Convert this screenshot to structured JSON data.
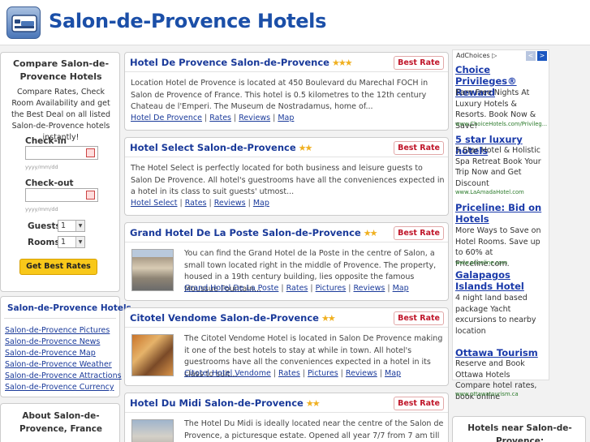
{
  "header": {
    "site_title": "Salon-de-Provence Hotels",
    "logo_icon": "hotel-bed-icon"
  },
  "compare": {
    "title": "Compare Salon-de-Provence Hotels",
    "description": "Compare Rates, Check Room Availability and get the Best Deal on all listed Salon-de-Provence hotels instantly!",
    "checkin_label": "Check-in",
    "checkin_hint": "yyyy/mm/dd",
    "checkout_label": "Check-out",
    "checkout_hint": "yyyy/mm/dd",
    "guests_label": "Guests",
    "guests_value": "1",
    "rooms_label": "Rooms",
    "rooms_value": "1",
    "button_label": "Get Best Rates"
  },
  "nav": {
    "title": "Salon-de-Provence Hotels",
    "links": [
      "Salon-de-Provence Pictures",
      "Salon-de-Provence News",
      "Salon-de-Provence Map",
      "Salon-de-Provence Weather",
      "Salon-de-Provence Attractions",
      "Salon-de-Provence Currency"
    ]
  },
  "about": {
    "title": "About Salon-de-Provence, France"
  },
  "hotels": [
    {
      "name": "Hotel De Provence Salon-de-Provence",
      "stars": "★★★",
      "best_rate": "Best Rate",
      "description": "Location Hotel de Provence is located at 450 Boulevard du Marechal FOCH in Salon de Provence of France. This hotel is 0.5 kilometres to the 12th century Chateau de l'Emperi. The Museum de Nostradamus, home of...",
      "links": [
        "Hotel De Provence",
        "Rates",
        "Reviews",
        "Map"
      ]
    },
    {
      "name": "Hotel Select Salon-de-Provence",
      "stars": "★★",
      "best_rate": "Best Rate",
      "description": "The Hotel Select is perfectly located for both business and leisure guests to Salon De Provence. All hotel's guestrooms have all the conveniences expected in a hotel in its class to suit guests' utmost...",
      "links": [
        "Hotel Select",
        "Rates",
        "Reviews",
        "Map"
      ]
    },
    {
      "name": "Grand Hotel De La Poste Salon-de-Provence",
      "stars": "★★",
      "best_rate": "Best Rate",
      "description": "You can find the Grand Hotel de la Poste in the centre of Salon, a small town located right in the middle of Provence. The property, housed in a 19th century building, lies opposite the famous Moussue Fountain...",
      "links": [
        "Grand Hotel De La Poste",
        "Rates",
        "Pictures",
        "Reviews",
        "Map"
      ]
    },
    {
      "name": "Citotel Vendome Salon-de-Provence",
      "stars": "★★",
      "best_rate": "Best Rate",
      "description": "The Citotel Vendome Hotel is located in Salon De Provence making it one of the best hotels to stay at while in town. All hotel's guestrooms have all the conveniences expected in a hotel in its class to suit...",
      "links": [
        "Citotel Hotel Vendome",
        "Rates",
        "Pictures",
        "Reviews",
        "Map"
      ]
    },
    {
      "name": "Hotel Du Midi Salon-de-Provence",
      "stars": "★★",
      "best_rate": "Best Rate",
      "description": "The Hotel Du Midi is ideally located near the centre of the Salon de Provence, a picturesque estate. Opened all year 7/7 from 7 am till 1"
    }
  ],
  "ads": {
    "label": "AdChoices",
    "items": [
      {
        "title": "Choice Privileges® Reward",
        "body": "Earn Free Nights At Luxury Hotels & Resorts. Book Now & Save!",
        "url": "www.ChoiceHotels.com/Privileg..."
      },
      {
        "title": "5 star luxury hotels",
        "body": "5 Star Hotel & Holistic Spa Retreat Book Your Trip Now and Get Discount",
        "url": "www.LaAmadaHotel.com"
      },
      {
        "title": "Priceline: Bid on Hotels",
        "body": "More Ways to Save on Hotel Rooms. Save up to 60% at Priceline.com.",
        "url": "www.priceline.com"
      },
      {
        "title": "Galapagos Islands Hotel",
        "body": "4 night land based package Yacht excursions to nearby location",
        "url": ""
      },
      {
        "title": "Ottawa Tourism",
        "body": "Reserve and Book Ottawa Hotels Compare hotel rates, book online",
        "url": "www.ottawatourism.ca"
      }
    ]
  },
  "nearby": {
    "title": "Hotels near Salon-de-Provence:"
  }
}
